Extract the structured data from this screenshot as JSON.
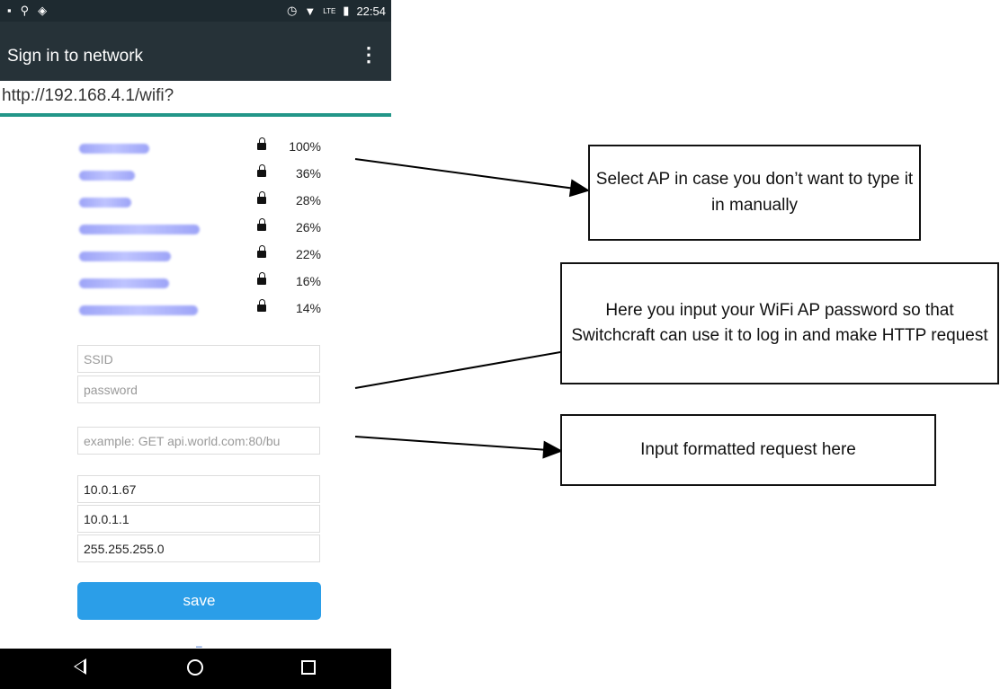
{
  "status_bar": {
    "time": "22:54",
    "network": "LTE"
  },
  "app_bar": {
    "title": "Sign in to network",
    "menu_icon": "more-vert-icon"
  },
  "url_bar": {
    "url": "http://192.168.4.1/wifi?"
  },
  "access_points": [
    {
      "signal": "100%"
    },
    {
      "signal": "36%"
    },
    {
      "signal": "28%"
    },
    {
      "signal": "26%"
    },
    {
      "signal": "22%"
    },
    {
      "signal": "16%"
    },
    {
      "signal": "14%"
    }
  ],
  "form": {
    "ssid_placeholder": "SSID",
    "password_placeholder": "password",
    "request_placeholder": "example: GET api.world.com:80/bu",
    "ip_value": "10.0.1.67",
    "gateway_value": "10.0.1.1",
    "subnet_value": "255.255.255.0",
    "save_label": "save"
  },
  "callouts": {
    "select_ap": "Select AP in case you don’t want to type it in manually",
    "password_note": "Here you input your WiFi AP password so that Switchcraft can use it to log in and make HTTP request",
    "request_note": "Input formatted request here"
  },
  "colors": {
    "accent": "#229688",
    "save_button": "#2b9ee8",
    "app_bar": "#263238"
  }
}
